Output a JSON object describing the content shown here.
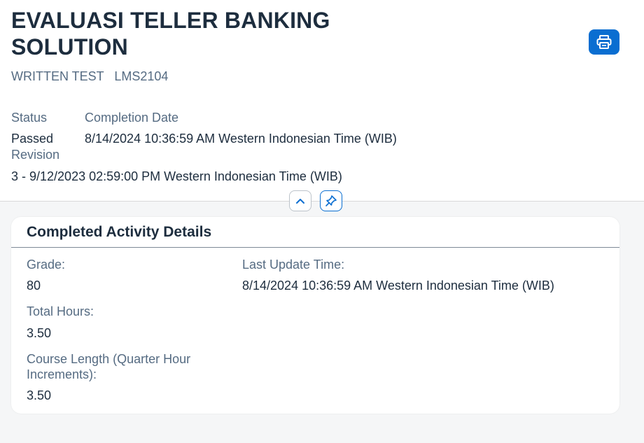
{
  "header": {
    "title": "EVALUASI TELLER BANKING SOLUTION",
    "subtitle_type": "WRITTEN TEST",
    "subtitle_code": "LMS2104",
    "print_icon": "printer-icon",
    "status_label": "Status",
    "status_value": "Passed",
    "completion_label": "Completion Date",
    "completion_value": "8/14/2024 10:36:59 AM Western Indonesian Time (WIB)",
    "revision_label": "Revision",
    "revision_value": "3 - 9/12/2023 02:59:00 PM Western Indonesian Time (WIB)",
    "collapse_icon": "chevron-up-icon",
    "pin_icon": "pin-icon"
  },
  "details": {
    "title": "Completed Activity Details",
    "grade_label": "Grade:",
    "grade_value": "80",
    "total_hours_label": "Total Hours:",
    "total_hours_value": "3.50",
    "course_length_label": "Course Length (Quarter Hour Increments):",
    "course_length_value": "3.50",
    "last_update_label": "Last Update Time:",
    "last_update_value": "8/14/2024 10:36:59 AM Western Indonesian Time (WIB)"
  },
  "colors": {
    "accent": "#0a6ed1",
    "text": "#1d2d3e",
    "label": "#556b82",
    "background": "#f5f6f7"
  }
}
